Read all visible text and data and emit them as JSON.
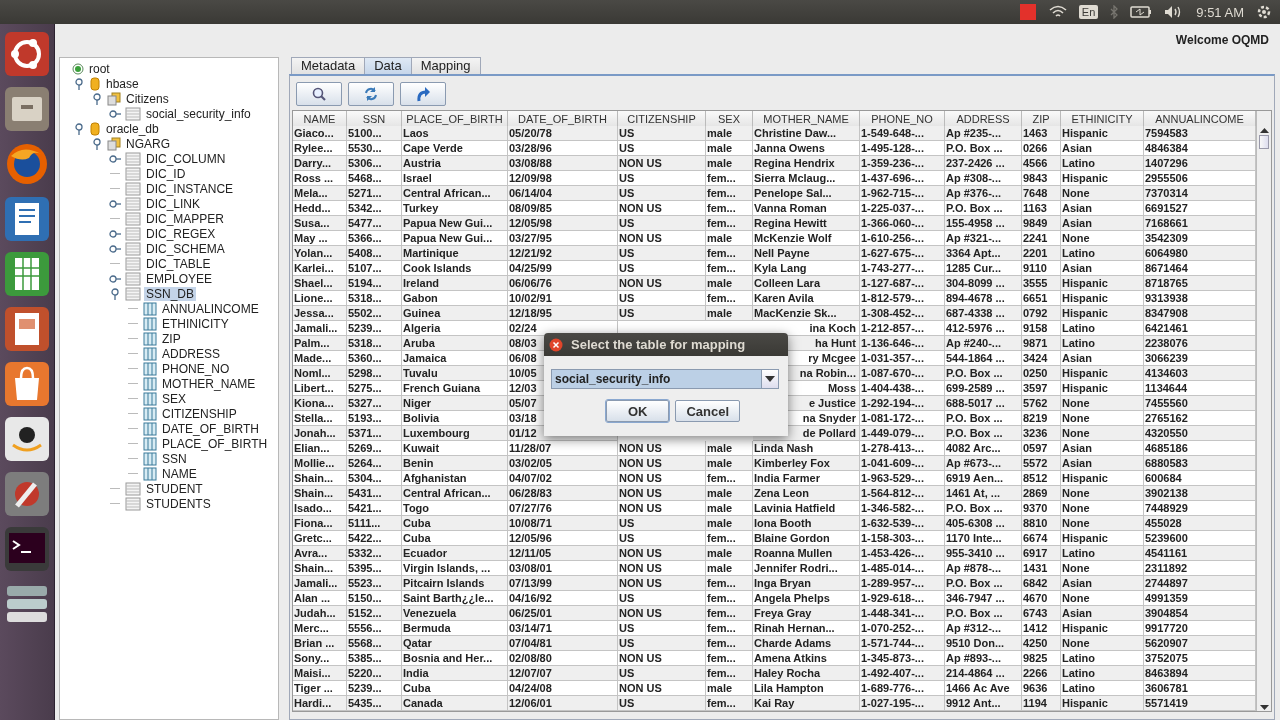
{
  "top_panel": {
    "keyboard_layout": "En",
    "clock": "9:51 AM"
  },
  "app": {
    "welcome": "Welcome OQMD"
  },
  "tree": {
    "label": "root",
    "kind": "root",
    "selected": false,
    "children": [
      {
        "label": "hbase",
        "kind": "database",
        "expanded": true,
        "selected": false,
        "children": [
          {
            "label": "Citizens",
            "kind": "schema",
            "expanded": true,
            "selected": false,
            "children": [
              {
                "label": "social_security_info",
                "kind": "table",
                "expanded": false,
                "selected": false
              }
            ]
          }
        ]
      },
      {
        "label": "oracle_db",
        "kind": "database",
        "expanded": true,
        "selected": false,
        "children": [
          {
            "label": "NGARG",
            "kind": "schema",
            "expanded": true,
            "selected": false,
            "children": [
              {
                "label": "DIC_COLUMN",
                "kind": "table",
                "expanded": false,
                "selected": false
              },
              {
                "label": "DIC_ID",
                "kind": "table",
                "selected": false
              },
              {
                "label": "DIC_INSTANCE",
                "kind": "table",
                "selected": false
              },
              {
                "label": "DIC_LINK",
                "kind": "table",
                "expanded": false,
                "selected": false
              },
              {
                "label": "DIC_MAPPER",
                "kind": "table",
                "selected": false
              },
              {
                "label": "DIC_REGEX",
                "kind": "table",
                "expanded": false,
                "selected": false
              },
              {
                "label": "DIC_SCHEMA",
                "kind": "table",
                "expanded": false,
                "selected": false
              },
              {
                "label": "DIC_TABLE",
                "kind": "table",
                "selected": false
              },
              {
                "label": "EMPLOYEE",
                "kind": "table",
                "expanded": false,
                "selected": false
              },
              {
                "label": "SSN_DB",
                "kind": "table",
                "expanded": true,
                "selected": true,
                "children": [
                  {
                    "label": "ANNUALINCOME",
                    "kind": "column",
                    "selected": false
                  },
                  {
                    "label": "ETHINICITY",
                    "kind": "column",
                    "selected": false
                  },
                  {
                    "label": "ZIP",
                    "kind": "column",
                    "selected": false
                  },
                  {
                    "label": "ADDRESS",
                    "kind": "column",
                    "selected": false
                  },
                  {
                    "label": "PHONE_NO",
                    "kind": "column",
                    "selected": false
                  },
                  {
                    "label": "MOTHER_NAME",
                    "kind": "column",
                    "selected": false
                  },
                  {
                    "label": "SEX",
                    "kind": "column",
                    "selected": false
                  },
                  {
                    "label": "CITIZENSHIP",
                    "kind": "column",
                    "selected": false
                  },
                  {
                    "label": "DATE_OF_BIRTH",
                    "kind": "column",
                    "selected": false
                  },
                  {
                    "label": "PLACE_OF_BIRTH",
                    "kind": "column",
                    "selected": false
                  },
                  {
                    "label": "SSN",
                    "kind": "column",
                    "selected": false
                  },
                  {
                    "label": "NAME",
                    "kind": "column",
                    "selected": false
                  }
                ]
              },
              {
                "label": "STUDENT",
                "kind": "table",
                "selected": false
              },
              {
                "label": "STUDENTS",
                "kind": "table",
                "selected": false
              }
            ]
          }
        ]
      }
    ]
  },
  "tabs": [
    {
      "label": "Metadata",
      "selected": false
    },
    {
      "label": "Data",
      "selected": true
    },
    {
      "label": "Mapping",
      "selected": false
    }
  ],
  "table": {
    "columns": [
      "NAME",
      "SSN",
      "PLACE_OF_BIRTH",
      "DATE_OF_BIRTH",
      "CITIZENSHIP",
      "SEX",
      "MOTHER_NAME",
      "PHONE_NO",
      "ADDRESS",
      "ZIP",
      "ETHINICITY",
      "ANNUALINCOME"
    ],
    "rows": [
      [
        "Giaco...",
        "5100...",
        "Laos",
        "05/20/78",
        "US",
        "male",
        "Christine Daw...",
        "1-549-648-...",
        "Ap #235-...",
        "1463",
        "Hispanic",
        "7594583"
      ],
      [
        "Rylee...",
        "5530...",
        "Cape Verde",
        "03/28/96",
        "US",
        "male",
        "Janna Owens",
        "1-495-128-...",
        "P.O. Box ...",
        "0266",
        "Asian",
        "4846384"
      ],
      [
        "Darry...",
        "5306...",
        "Austria",
        "03/08/88",
        "NON US",
        "male",
        "Regina Hendrix",
        "1-359-236-...",
        "237-2426 ...",
        "4566",
        "Latino",
        "1407296"
      ],
      [
        "Ross ...",
        "5468...",
        "Israel",
        "12/09/98",
        "US",
        "fem...",
        "Sierra Mclaug...",
        "1-437-696-...",
        "Ap #308-...",
        "9843",
        "Hispanic",
        "2955506"
      ],
      [
        "Mela...",
        "5271...",
        "Central African...",
        "06/14/04",
        "US",
        "fem...",
        "Penelope Sal...",
        "1-962-715-...",
        "Ap #376-...",
        "7648",
        "None",
        "7370314"
      ],
      [
        "Hedd...",
        "5342...",
        "Turkey",
        "08/09/85",
        "NON US",
        "fem...",
        "Vanna Roman",
        "1-225-037-...",
        "P.O. Box ...",
        "1163",
        "Asian",
        "6691527"
      ],
      [
        "Susa...",
        "5477...",
        "Papua New Gui...",
        "12/05/98",
        "US",
        "fem...",
        "Regina Hewitt",
        "1-366-060-...",
        "155-4958 ...",
        "9849",
        "Asian",
        "7168661"
      ],
      [
        "May ...",
        "5366...",
        "Papua New Gui...",
        "03/27/95",
        "NON US",
        "male",
        "McKenzie Wolf",
        "1-610-256-...",
        "Ap #321-...",
        "2241",
        "None",
        "3542309"
      ],
      [
        "Yolan...",
        "5408...",
        "Martinique",
        "12/21/92",
        "US",
        "fem...",
        "Nell Payne",
        "1-627-675-...",
        "3364 Apt...",
        "2201",
        "Latino",
        "6064980"
      ],
      [
        "Karlei...",
        "5107...",
        "Cook Islands",
        "04/25/99",
        "US",
        "fem...",
        "Kyla Lang",
        "1-743-277-...",
        "1285 Cur...",
        "9110",
        "Asian",
        "8671464"
      ],
      [
        "Shael...",
        "5194...",
        "Ireland",
        "06/06/76",
        "NON US",
        "male",
        "Colleen Lara",
        "1-127-687-...",
        "304-8099 ...",
        "3555",
        "Hispanic",
        "8718765"
      ],
      [
        "Lione...",
        "5318...",
        "Gabon",
        "10/02/91",
        "US",
        "fem...",
        "Karen Avila",
        "1-812-579-...",
        "894-4678 ...",
        "6651",
        "Hispanic",
        "9313938"
      ],
      [
        "Jessa...",
        "5502...",
        "Guinea",
        "12/18/95",
        "US",
        "male",
        "MacKenzie Sk...",
        "1-308-452-...",
        "687-4338 ...",
        "0792",
        "Hispanic",
        "8347908"
      ],
      [
        "Jamali...",
        "5239...",
        "Algeria",
        "02/24",
        null,
        null,
        "ina Koch",
        "1-212-857-...",
        "412-5976 ...",
        "9158",
        "Latino",
        "6421461"
      ],
      [
        "Palm...",
        "5318...",
        "Aruba",
        "08/03",
        null,
        null,
        "ha Hunt",
        "1-136-646-...",
        "Ap #240-...",
        "9871",
        "Latino",
        "2238076"
      ],
      [
        "Made...",
        "5360...",
        "Jamaica",
        "06/08",
        null,
        null,
        "ry Mcgee",
        "1-031-357-...",
        "544-1864 ...",
        "3424",
        "Asian",
        "3066239"
      ],
      [
        "Noml...",
        "5298...",
        "Tuvalu",
        "10/05",
        null,
        null,
        "na Robin...",
        "1-087-670-...",
        "P.O. Box ...",
        "0250",
        "Hispanic",
        "4134603"
      ],
      [
        "Libert...",
        "5275...",
        "French Guiana",
        "12/03",
        null,
        null,
        "Moss",
        "1-404-438-...",
        "699-2589 ...",
        "3597",
        "Hispanic",
        "1134644"
      ],
      [
        "Kiona...",
        "5327...",
        "Niger",
        "05/07",
        null,
        null,
        "e Justice",
        "1-292-194-...",
        "688-5017 ...",
        "5762",
        "None",
        "7455560"
      ],
      [
        "Stella...",
        "5193...",
        "Bolivia",
        "03/18",
        null,
        null,
        "na Snyder",
        "1-081-172-...",
        "P.O. Box ...",
        "8219",
        "None",
        "2765162"
      ],
      [
        "Jonah...",
        "5371...",
        "Luxembourg",
        "01/12",
        null,
        null,
        "de Pollard",
        "1-449-079-...",
        "P.O. Box ...",
        "3236",
        "None",
        "4320550"
      ],
      [
        "Elian...",
        "5269...",
        "Kuwait",
        "11/28/07",
        "NON US",
        "male",
        "Linda Nash",
        "1-278-413-...",
        "4082 Arc...",
        "0597",
        "Asian",
        "4685186"
      ],
      [
        "Mollie...",
        "5264...",
        "Benin",
        "03/02/05",
        "NON US",
        "male",
        "Kimberley Fox",
        "1-041-609-...",
        "Ap #673-...",
        "5572",
        "Asian",
        "6880583"
      ],
      [
        "Shain...",
        "5304...",
        "Afghanistan",
        "04/07/02",
        "NON US",
        "fem...",
        "India Farmer",
        "1-963-529-...",
        "6919 Aen...",
        "8512",
        "Hispanic",
        "600684"
      ],
      [
        "Shain...",
        "5431...",
        "Central African...",
        "06/28/83",
        "NON US",
        "male",
        "Zena Leon",
        "1-564-812-...",
        "1461 At, ...",
        "2869",
        "None",
        "3902138"
      ],
      [
        "Isado...",
        "5421...",
        "Togo",
        "07/27/76",
        "NON US",
        "male",
        "Lavinia Hatfield",
        "1-346-582-...",
        "P.O. Box ...",
        "9370",
        "None",
        "7448929"
      ],
      [
        "Fiona...",
        "5111...",
        "Cuba",
        "10/08/71",
        "US",
        "male",
        "Iona Booth",
        "1-632-539-...",
        "405-6308 ...",
        "8810",
        "None",
        "455028"
      ],
      [
        "Gretc...",
        "5422...",
        "Cuba",
        "12/05/96",
        "US",
        "fem...",
        "Blaine Gordon",
        "1-158-303-...",
        "1170 Inte...",
        "6674",
        "Hispanic",
        "5239600"
      ],
      [
        "Avra...",
        "5332...",
        "Ecuador",
        "12/11/05",
        "NON US",
        "male",
        "Roanna Mullen",
        "1-453-426-...",
        "955-3410 ...",
        "6917",
        "Latino",
        "4541161"
      ],
      [
        "Shain...",
        "5395...",
        "Virgin Islands, ...",
        "03/08/01",
        "NON US",
        "male",
        "Jennifer Rodri...",
        "1-485-014-...",
        "Ap #878-...",
        "1431",
        "None",
        "2311892"
      ],
      [
        "Jamali...",
        "5523...",
        "Pitcairn Islands",
        "07/13/99",
        "NON US",
        "fem...",
        "Inga Bryan",
        "1-289-957-...",
        "P.O. Box ...",
        "6842",
        "Asian",
        "2744897"
      ],
      [
        "Alan ...",
        "5150...",
        "Saint Barth¿¿le...",
        "04/16/92",
        "US",
        "fem...",
        "Angela Phelps",
        "1-929-618-...",
        "346-7947 ...",
        "4670",
        "None",
        "4991359"
      ],
      [
        "Judah...",
        "5152...",
        "Venezuela",
        "06/25/01",
        "NON US",
        "fem...",
        "Freya Gray",
        "1-448-341-...",
        "P.O. Box ...",
        "6743",
        "Asian",
        "3904854"
      ],
      [
        "Merc...",
        "5556...",
        "Bermuda",
        "03/14/71",
        "US",
        "fem...",
        "Rinah Hernan...",
        "1-070-252-...",
        "Ap #312-...",
        "1412",
        "Hispanic",
        "9917720"
      ],
      [
        "Brian ...",
        "5568...",
        "Qatar",
        "07/04/81",
        "US",
        "fem...",
        "Charde Adams",
        "1-571-744-...",
        "9510 Don...",
        "4250",
        "None",
        "5620907"
      ],
      [
        "Sony...",
        "5385...",
        "Bosnia and Her...",
        "02/08/80",
        "NON US",
        "fem...",
        "Amena Atkins",
        "1-345-873-...",
        "Ap #893-...",
        "9825",
        "Latino",
        "3752075"
      ],
      [
        "Maisi...",
        "5220...",
        "India",
        "12/07/07",
        "US",
        "fem...",
        "Haley Rocha",
        "1-492-407-...",
        "214-4864 ...",
        "2266",
        "Latino",
        "8463894"
      ],
      [
        "Tiger ...",
        "5239...",
        "Cuba",
        "04/24/08",
        "NON US",
        "male",
        "Lila Hampton",
        "1-689-776-...",
        "1466 Ac Ave",
        "9636",
        "Latino",
        "3606781"
      ],
      [
        "Hardi...",
        "5435...",
        "Canada",
        "12/06/01",
        "US",
        "fem...",
        "Kai Ray",
        "1-027-195-...",
        "9912 Ant...",
        "1194",
        "Hispanic",
        "5571419"
      ]
    ]
  },
  "dialog": {
    "title": "Select the table for mapping",
    "dropdown_value": "social_security_info",
    "buttons": [
      "OK",
      "Cancel"
    ]
  }
}
